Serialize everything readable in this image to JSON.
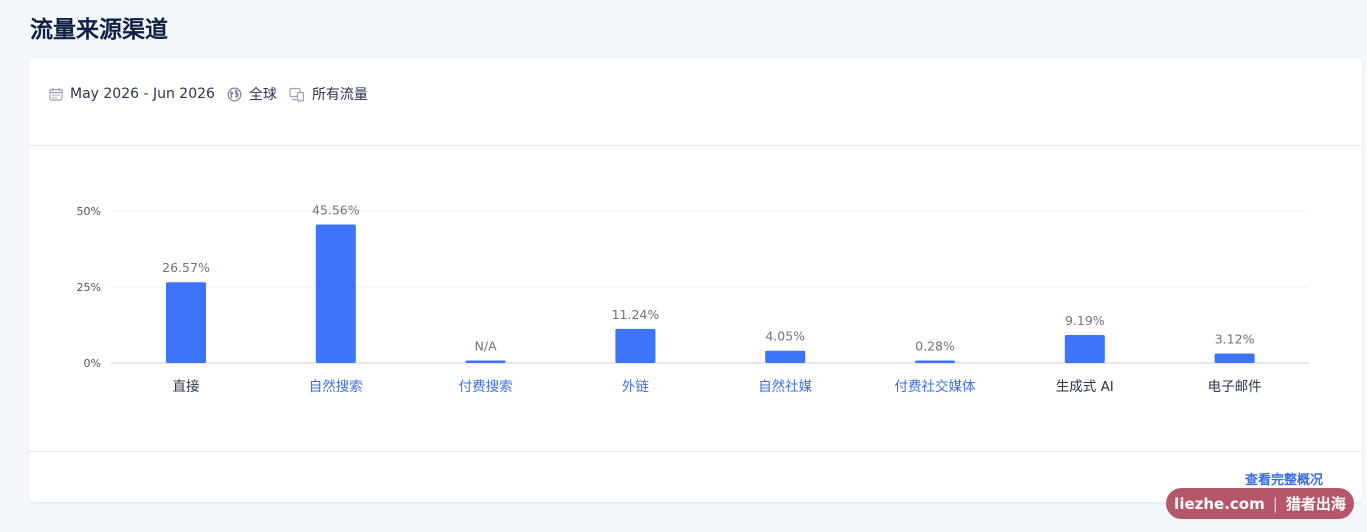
{
  "page": {
    "title": "流量来源渠道"
  },
  "filters": {
    "date_range": "May 2026 - Jun 2026",
    "region": "全球",
    "traffic": "所有流量"
  },
  "footer": {
    "full_overview_label": "查看完整概况"
  },
  "watermark": {
    "site": "liezhe.com",
    "separator": "|",
    "brand": "猎者出海"
  },
  "colors": {
    "bar": "#3d74fb",
    "link": "#3b6fe0",
    "label_default": "#2b3550",
    "value_label": "#6b7386"
  },
  "chart_data": {
    "type": "bar",
    "title": "",
    "xlabel": "",
    "ylabel": "",
    "ylim": [
      0,
      50
    ],
    "yticks": [
      0,
      25,
      50
    ],
    "ytick_labels": [
      "0%",
      "25%",
      "50%"
    ],
    "grid": true,
    "categories": [
      "直接",
      "自然搜索",
      "付费搜索",
      "外链",
      "自然社媒",
      "付费社交媒体",
      "生成式 AI",
      "电子邮件"
    ],
    "values": [
      26.57,
      45.56,
      0,
      11.24,
      4.05,
      0.28,
      9.19,
      3.12
    ],
    "value_labels": [
      "26.57%",
      "45.56%",
      "N/A",
      "11.24%",
      "4.05%",
      "0.28%",
      "9.19%",
      "3.12%"
    ],
    "category_is_link": [
      false,
      true,
      true,
      true,
      true,
      true,
      false,
      false
    ]
  }
}
